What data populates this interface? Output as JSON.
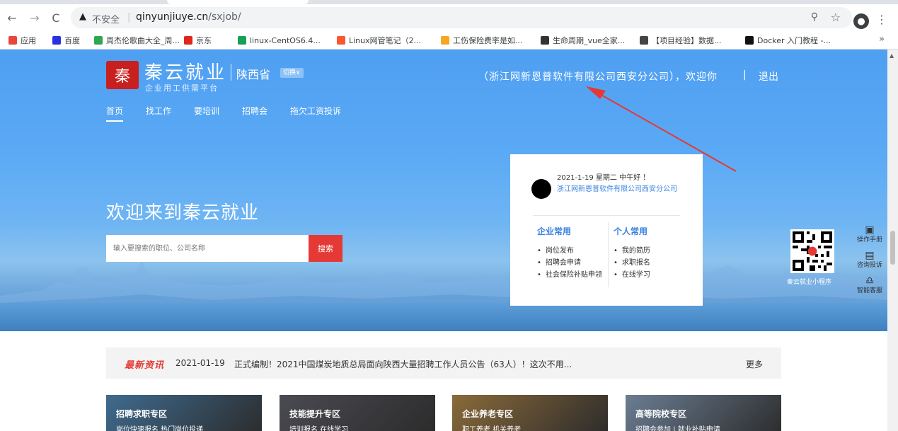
{
  "browser": {
    "security_label": "不安全",
    "url_host": "qinyunjiuye.cn",
    "url_path": "/sxjob/",
    "bookmarks": [
      {
        "label": "应用",
        "icon": "apps-grid-icon",
        "color": "#e8453c"
      },
      {
        "label": "百度",
        "icon": "baidu-paw-icon",
        "color": "#2932e1"
      },
      {
        "label": "周杰伦歌曲大全_周...",
        "icon": "music-icon",
        "color": "#2ea84f"
      },
      {
        "label": "京东",
        "icon": "jd-icon",
        "color": "#e1251b"
      },
      {
        "label": "linux-CentOS6.4...",
        "icon": "c-logo-icon",
        "color": "#18a058"
      },
      {
        "label": "Linux网管笔记（2...",
        "icon": "c-logo-icon",
        "color": "#fc5531"
      },
      {
        "label": "工伤保险费率是如...",
        "icon": "browser-icon",
        "color": "#f5a623"
      },
      {
        "label": "生命周期_vue全家...",
        "icon": "github-icon",
        "color": "#333333"
      },
      {
        "label": "【项目经验】数据...",
        "icon": "leaf-icon",
        "color": "#444444"
      },
      {
        "label": "Docker 入门教程 -...",
        "icon": "brush-icon",
        "color": "#111111"
      }
    ]
  },
  "header": {
    "logo_char": "秦",
    "brand_name": "秦云就业",
    "brand_sub": "企业用工供需平台",
    "region": "陕西省",
    "switch_label": "切换∨",
    "welcome": "（浙江网新恩普软件有限公司西安分公司），欢迎你",
    "divider": "|",
    "logout": "退出",
    "nav": [
      "首页",
      "找工作",
      "要培训",
      "招聘会",
      "拖欠工资投诉"
    ]
  },
  "hero": {
    "title": "欢迎来到秦云就业",
    "search_placeholder": "输入要搜索的职位、公司名称",
    "search_button": "搜索"
  },
  "user_card": {
    "date_greeting": "2021-1-19 星期二 中午好 ！",
    "company": "浙江网新恩普软件有限公司西安分公司",
    "enterprise_title": "企业常用",
    "enterprise_items": [
      "岗位发布",
      "招聘会申请",
      "社会保险补贴申领"
    ],
    "personal_title": "个人常用",
    "personal_items": [
      "我的简历",
      "求职报名",
      "在线学习"
    ]
  },
  "qr": {
    "caption": "秦云就业小程序"
  },
  "side_tools": [
    {
      "label": "操作手册",
      "icon": "manual-icon"
    },
    {
      "label": "咨询投诉",
      "icon": "chat-icon"
    },
    {
      "label": "智能客服",
      "icon": "headset-icon"
    }
  ],
  "news": {
    "tag": "最新资讯",
    "date": "2021-01-19",
    "title": "正式编制！2021中国煤炭地质总局面向陕西大量招聘工作人员公告（63人）！这次不用...",
    "more": "更多"
  },
  "zones": [
    {
      "title": "招聘求职专区",
      "sub": "岗位快速报名  热门岗位投递",
      "color": "#3f6b8f"
    },
    {
      "title": "技能提升专区",
      "sub": "培训报名  在线学习",
      "color": "#4a4a52"
    },
    {
      "title": "企业养老专区",
      "sub": "职工养老  机关养老",
      "color": "#8a6a3a"
    },
    {
      "title": "高等院校专区",
      "sub": "招聘会参加  | 就业补贴申请",
      "color": "#6b7d93"
    }
  ]
}
